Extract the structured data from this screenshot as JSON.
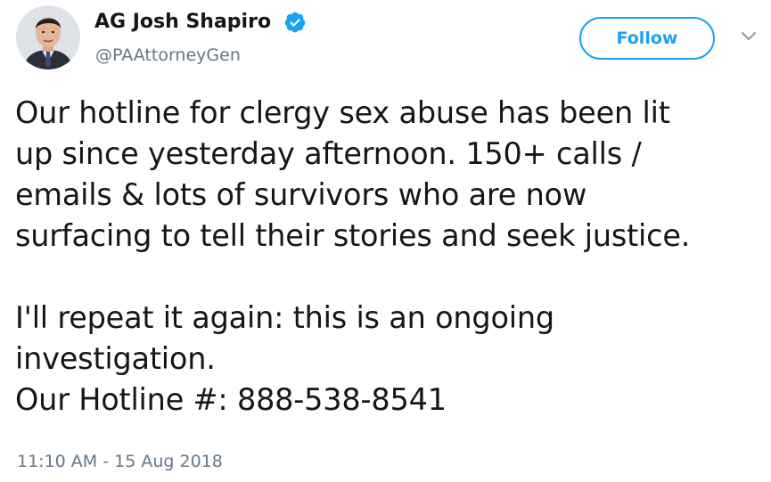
{
  "author": {
    "display_name": "AG Josh Shapiro",
    "handle": "@PAAttorneyGen",
    "verified": true,
    "avatar_icon": "profile-photo"
  },
  "actions": {
    "follow_label": "Follow",
    "menu_icon": "chevron-down-icon"
  },
  "tweet": {
    "lines": [
      "Our hotline for clergy sex abuse has been lit",
      "up since yesterday afternoon. 150+ calls /",
      "emails & lots of survivors who are now",
      "surfacing to tell their stories and seek justice.",
      "",
      "I'll repeat it again: this is an ongoing",
      "investigation.",
      "Our Hotline #: 888-538-8541"
    ],
    "timestamp": "11:10 AM - 15 Aug 2018"
  },
  "colors": {
    "brand_blue": "#1da1f2",
    "text_primary": "#14171a",
    "text_secondary": "#657786"
  }
}
